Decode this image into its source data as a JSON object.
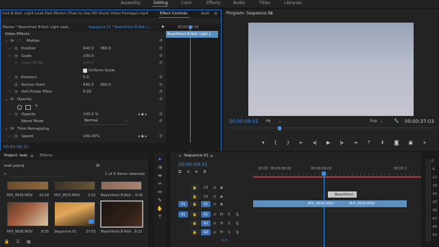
{
  "nav": {
    "items": [
      "Assembly",
      "Editing",
      "Color",
      "Effects",
      "Audio",
      "Titles",
      "Libraries"
    ],
    "active": "Editing"
  },
  "source_tabs": {
    "clip_title": "ront B-Roll- Light Leak Fast Motion (Free to Use HD Stock Video Footage).mp4",
    "effect_controls": "Effect Controls",
    "audio_mixer": "Audi",
    "menu_icon": "hamburger-menu-icon"
  },
  "effect_controls": {
    "master": "Master * Beachfront B-Roll- Light Leak...",
    "sequence": "Sequence 01 * Beachfront B-Roll- L...",
    "ruler_time": "00:00:09:30",
    "clip_label": "Beachfront B-Roll- Light L",
    "section_video_effects": "Video Effects",
    "motion": "Motion",
    "position": "Position",
    "position_x": "640.0",
    "position_y": "360.0",
    "scale": "Scale",
    "scale_value": "100.0",
    "scale_width": "Scale Width",
    "scale_width_value": "100.0",
    "uniform_scale": "Uniform Scale",
    "rotation": "Rotation",
    "rotation_value": "0.0",
    "anchor_point": "Anchor Point",
    "anchor_x": "640.0",
    "anchor_y": "360.0",
    "anti_flicker": "Anti-flicker Filter",
    "anti_flicker_value": "0.00",
    "opacity_section": "Opacity",
    "opacity": "Opacity",
    "opacity_value": "100.0 %",
    "blend_mode": "Blend Mode",
    "blend_mode_value": "Normal",
    "time_remapping": "Time Remapping",
    "speed": "Speed",
    "speed_value": "100.00%",
    "timecode": "00:00:09:31"
  },
  "program": {
    "title": "Program: Sequence 01",
    "timecode": "00:00:09:31",
    "fit": "Fit",
    "quality": "Full",
    "duration": "00:00:37:03"
  },
  "project": {
    "tab_project": "Project: leak",
    "tab_effects": "Effects",
    "file": "leak.prproj",
    "items_selected": "1 of 9 items selected",
    "clips": [
      {
        "name": "MVI_9939.MOV",
        "dur": "24:18"
      },
      {
        "name": "MVI_9933.MOV",
        "dur": "3:12"
      },
      {
        "name": "Beachfront B-Roll-...",
        "dur": "9:26"
      },
      {
        "name": "MVI_9936.MOV",
        "dur": "8:35"
      },
      {
        "name": "Sequence 01",
        "dur": "37:03"
      },
      {
        "name": "Beachfront B-Roll-...",
        "dur": "9:22"
      }
    ]
  },
  "timeline": {
    "tab": "Sequence 01",
    "timecode": "00:00:09:31",
    "ticks": [
      "00:00",
      "00:00:08:00",
      "00:00:09:00",
      "00:00:1"
    ],
    "tracks_video": [
      "V3",
      "V2",
      "V1"
    ],
    "tracks_audio": [
      "A1",
      "A2",
      "A3"
    ],
    "clip_v2": "Beachfront",
    "clip_v1a": "MVI_9929.MOV",
    "clip_v1b": "MVI_9933.MOV",
    "volume": "0.0",
    "targets": [
      "V1",
      "A1"
    ]
  },
  "meter": {
    "labels": [
      "0",
      "-6",
      "-12",
      "-18",
      "-24",
      "-30",
      "-36",
      "-42",
      "-48",
      "-54"
    ]
  },
  "colors": {
    "accent": "#3e8de8",
    "clip_video": "#5b8fc0",
    "clip_audio": "#57a36e"
  }
}
